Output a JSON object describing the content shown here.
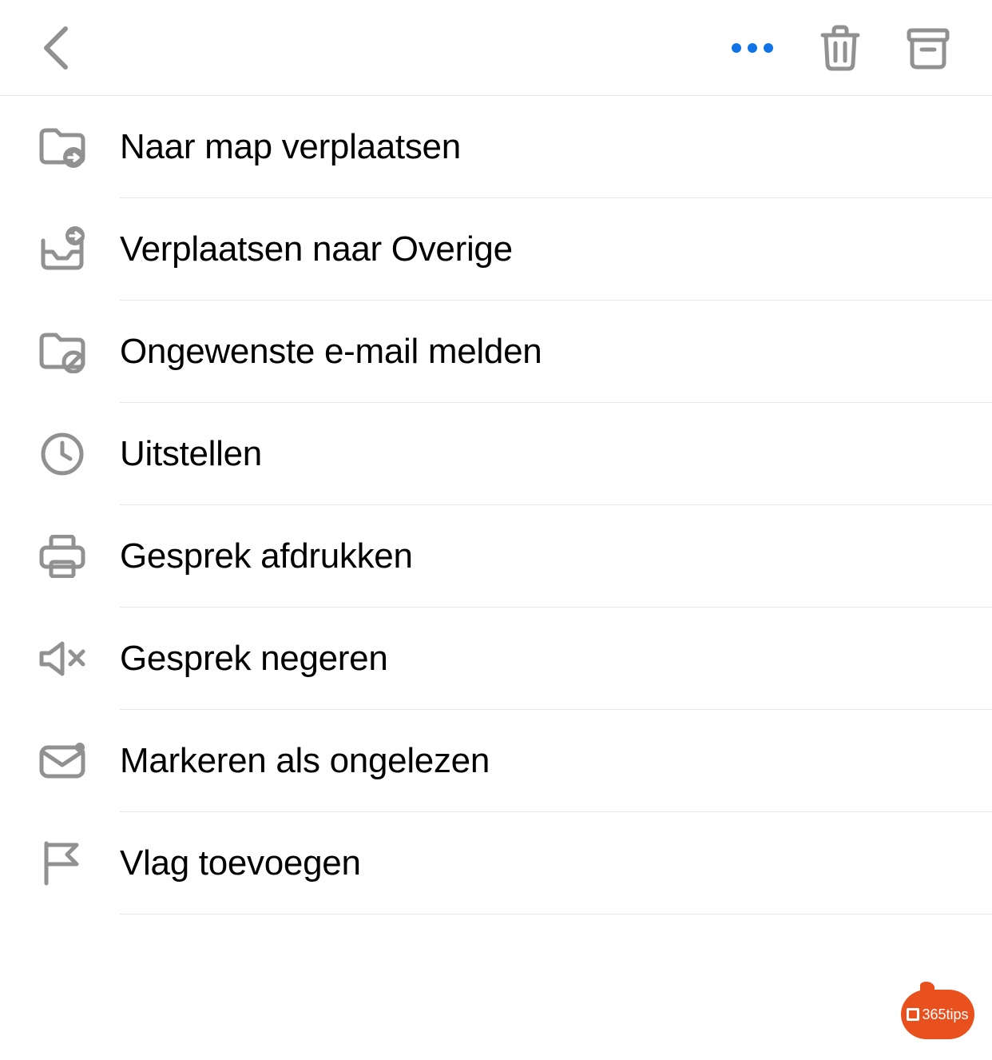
{
  "header": {
    "back": "Back",
    "more": "More",
    "delete": "Delete",
    "archive": "Archive"
  },
  "menu": {
    "items": [
      {
        "icon": "folder-move-icon",
        "label": "Naar map verplaatsen"
      },
      {
        "icon": "move-to-other-icon",
        "label": "Verplaatsen naar Overige"
      },
      {
        "icon": "report-junk-icon",
        "label": "Ongewenste e-mail melden"
      },
      {
        "icon": "clock-icon",
        "label": "Uitstellen"
      },
      {
        "icon": "print-icon",
        "label": "Gesprek afdrukken"
      },
      {
        "icon": "mute-icon",
        "label": "Gesprek negeren"
      },
      {
        "icon": "mark-unread-icon",
        "label": "Markeren als ongelezen"
      },
      {
        "icon": "flag-icon",
        "label": "Vlag toevoegen"
      }
    ]
  },
  "badge": {
    "text": "365tips"
  },
  "colors": {
    "icon_grey": "#919191",
    "accent_blue": "#1273e6",
    "badge_bg": "#e8501e",
    "divider": "#e8e8e8"
  }
}
